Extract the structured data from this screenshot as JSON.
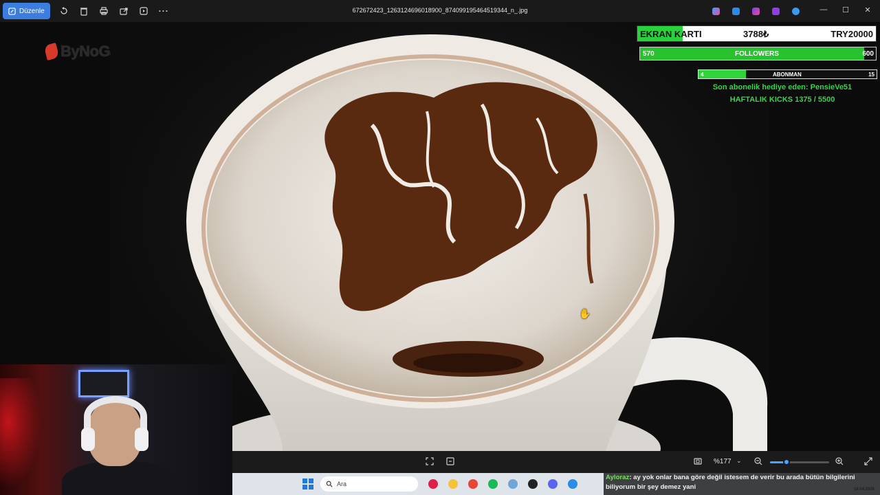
{
  "toolbar": {
    "edit_label": "Düzenle",
    "icons": [
      "rotate-icon",
      "delete-icon",
      "print-icon",
      "share-icon",
      "slideshow-icon",
      "more-icon"
    ],
    "more_label": "···"
  },
  "file": {
    "title": "672672423_1263124696018900_874099195464519344_n_.jpg"
  },
  "window_controls": {
    "minimize": "—",
    "maximize": "☐",
    "close": "✕"
  },
  "logo": {
    "text": "ByNoGame"
  },
  "overlay": {
    "goal": {
      "label": "EKRAN KARTI",
      "current": "3788₺",
      "target": "TRY20000",
      "progress_pct": 18.9
    },
    "followers": {
      "current": "570",
      "label": "FOLLOWERS",
      "target": "600",
      "progress_pct": 95
    },
    "subscribers": {
      "current": "4",
      "label": "ABONMAN",
      "target": "15",
      "progress_pct": 26.7
    },
    "last_gift": "Son abonelik hediye eden: PensieVe51",
    "weekly_kicks": "HAFTALIK KICKS 1375 / 5500"
  },
  "viewer": {
    "zoom_label": "%177",
    "zoom_pct": 28
  },
  "taskbar": {
    "search_placeholder": "Ara",
    "apps": [
      {
        "name": "media-app",
        "color": "#e0204a"
      },
      {
        "name": "folder-app",
        "color": "#f5c23c"
      },
      {
        "name": "chrome-app",
        "color": "#e84537"
      },
      {
        "name": "spotify-app",
        "color": "#1db954"
      },
      {
        "name": "settings-app",
        "color": "#6fa8d8"
      },
      {
        "name": "github-app",
        "color": "#222222"
      },
      {
        "name": "discord-app",
        "color": "#5865f2"
      },
      {
        "name": "photos-app",
        "color": "#2b8be8"
      }
    ],
    "date": "18.04.2026"
  },
  "chat": {
    "user": "Ayloraz",
    "message": ": ay yok onlar bana göre değil istesem de verir bu arada bütün bilgilerini biliyorum bir şey demez yani"
  }
}
